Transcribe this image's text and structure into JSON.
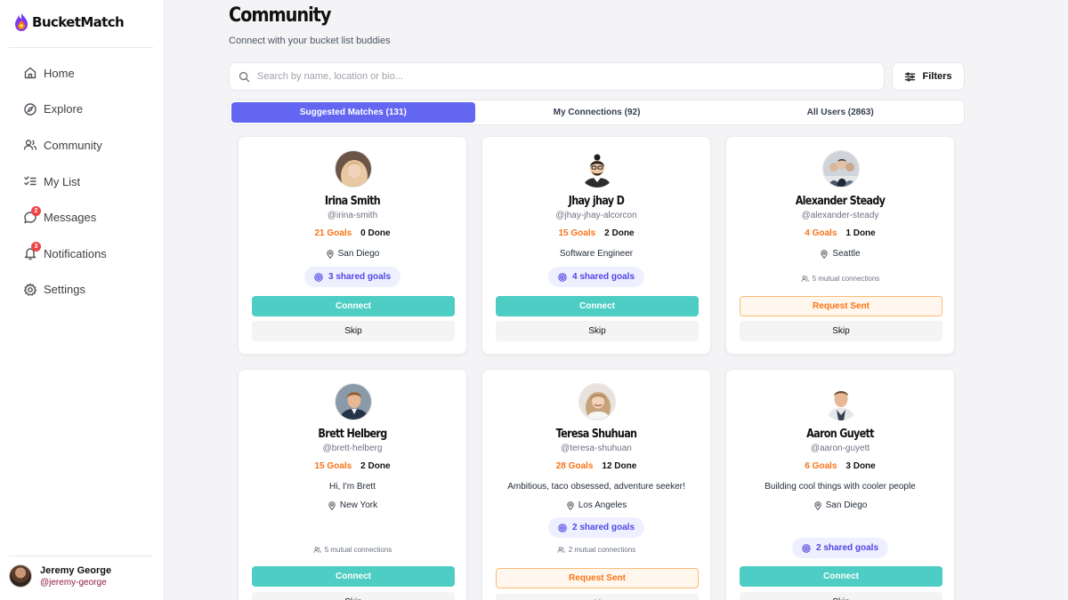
{
  "app": {
    "name": "BucketMatch",
    "brand_color": "#6366f1",
    "accent_color": "#4ecdc4"
  },
  "sidebar": {
    "items": [
      {
        "label": "Home",
        "icon": "home-icon"
      },
      {
        "label": "Explore",
        "icon": "compass-icon"
      },
      {
        "label": "Community",
        "icon": "users-icon"
      },
      {
        "label": "My List",
        "icon": "checklist-icon"
      },
      {
        "label": "Messages",
        "icon": "message-icon",
        "badge": "2"
      },
      {
        "label": "Notifications",
        "icon": "bell-icon",
        "badge": "3"
      },
      {
        "label": "Settings",
        "icon": "gear-icon"
      }
    ],
    "user": {
      "name": "Jeremy George",
      "handle": "@jeremy-george"
    }
  },
  "page": {
    "title": "Community",
    "subtitle": "Connect with your bucket list buddies",
    "search_placeholder": "Search by name, location or bio...",
    "filters_label": "Filters",
    "tabs": [
      {
        "label": "Suggested Matches (131)",
        "active": true
      },
      {
        "label": "My Connections (92)",
        "active": false
      },
      {
        "label": "All Users (2863)",
        "active": false
      }
    ]
  },
  "labels": {
    "connect": "Connect",
    "request_sent": "Request Sent",
    "skip": "Skip"
  },
  "cards": [
    {
      "name": "Irina Smith",
      "handle": "@irina-smith",
      "goals": "21 Goals",
      "done": "0 Done",
      "bio": "",
      "location": "San Diego",
      "shared": "3 shared goals",
      "mutual": "",
      "action": "Connect"
    },
    {
      "name": "Jhay jhay D",
      "handle": "@jhay-jhay-alcorcon",
      "goals": "15 Goals",
      "done": "2 Done",
      "bio": "Software Engineer",
      "location": "",
      "shared": "4 shared goals",
      "mutual": "",
      "action": "Connect"
    },
    {
      "name": "Alexander Steady",
      "handle": "@alexander-steady",
      "goals": "4 Goals",
      "done": "1 Done",
      "bio": "",
      "location": "Seattle",
      "shared": "",
      "mutual": "5 mutual connections",
      "action": "Request Sent"
    },
    {
      "name": "Brett Helberg",
      "handle": "@brett-helberg",
      "goals": "15 Goals",
      "done": "2 Done",
      "bio": "Hi, I'm Brett",
      "location": "New York",
      "shared": "",
      "mutual": "5 mutual connections",
      "action": "Connect"
    },
    {
      "name": "Teresa Shuhuan",
      "handle": "@teresa-shuhuan",
      "goals": "28 Goals",
      "done": "12 Done",
      "bio": "Ambitious, taco obsessed, adventure seeker!",
      "location": "Los Angeles",
      "shared": "2 shared goals",
      "mutual": "2 mutual connections",
      "action": "Request Sent"
    },
    {
      "name": "Aaron Guyett",
      "handle": "@aaron-guyett",
      "goals": "6 Goals",
      "done": "3 Done",
      "bio": "Building cool things with cooler people",
      "location": "San Diego",
      "shared": "2 shared goals",
      "mutual": "",
      "action": "Connect"
    }
  ]
}
